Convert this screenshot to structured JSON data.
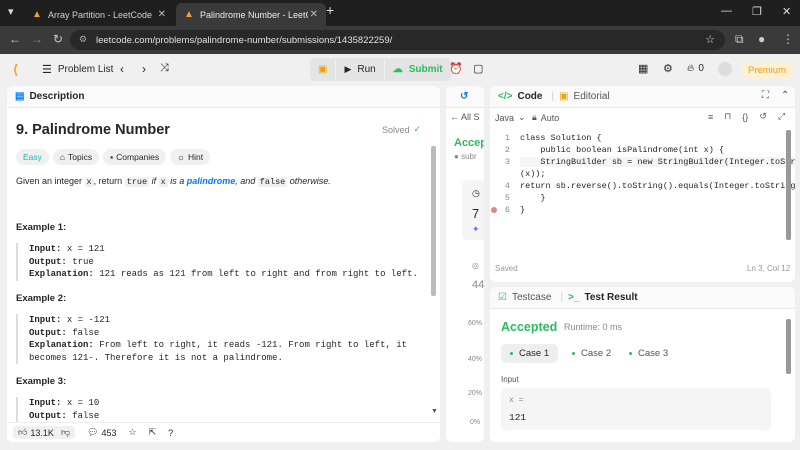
{
  "browser": {
    "tabs": [
      {
        "title": "Array Partition - LeetCode",
        "active": false
      },
      {
        "title": "Palindrome Number - LeetCode",
        "active": true
      }
    ],
    "url": "leetcode.com/problems/palindrome-number/submissions/1435822259/"
  },
  "nav": {
    "problem_list": "Problem List",
    "run": "Run",
    "submit": "Submit",
    "streak": "0",
    "premium": "Premium"
  },
  "description": {
    "tab_label": "Description",
    "title": "9. Palindrome Number",
    "solved": "Solved",
    "tags": [
      "Easy",
      "Topics",
      "Companies",
      "Hint"
    ],
    "intro": {
      "p1": "Given an integer ",
      "c1": "x",
      "p2": ", return ",
      "c2": "true",
      "p3": " if ",
      "c3": "x",
      "p4": " is a ",
      "link": "palindrome",
      "p5": ", and ",
      "c4": "false",
      "p6": " otherwise."
    },
    "examples": [
      {
        "title": "Example 1:",
        "input_label": "Input:",
        "input": "x = 121",
        "output_label": "Output:",
        "output": "true",
        "explanation_label": "Explanation:",
        "explanation": "121 reads as 121 from left to right and from right to left."
      },
      {
        "title": "Example 2:",
        "input_label": "Input:",
        "input": "x = -121",
        "output_label": "Output:",
        "output": "false",
        "explanation_label": "Explanation:",
        "explanation": "From left to right, it reads -121. From right to left, it becomes 121-. Therefore it is not a palindrome."
      },
      {
        "title": "Example 3:",
        "input_label": "Input:",
        "input": "x = 10",
        "output_label": "Output:",
        "output": "false"
      }
    ],
    "likes": "13.1K",
    "comments": "453"
  },
  "submission": {
    "tab_label": "All S",
    "status": "Accep",
    "sub_label": "subr",
    "runtime_digit": "7",
    "stat": "44",
    "axis": [
      "60%",
      "40%",
      "20%",
      "0%"
    ]
  },
  "code": {
    "tab_code": "Code",
    "tab_editorial": "Editorial",
    "language": "Java",
    "mode": "Auto",
    "status": "Saved",
    "cursor": "Ln 3, Col 12",
    "line_numbers": [
      "1",
      "2",
      "3",
      "",
      "4",
      "5",
      "6"
    ],
    "lines": [
      "class Solution {",
      "    public boolean isPalindrome(int x) {",
      "    StringBuilder sb = new StringBuilder(Integer.toString",
      "(x));",
      "return sb.reverse().toString().equals(Integer.toString(x));",
      "    }",
      "}"
    ]
  },
  "tests": {
    "tab_testcase": "Testcase",
    "tab_result": "Test Result",
    "result": "Accepted",
    "runtime": "Runtime: 0 ms",
    "cases": [
      "Case 1",
      "Case 2",
      "Case 3"
    ],
    "input_label": "Input",
    "var_label": "x =",
    "var_value": "121"
  },
  "colors": {
    "accent_green": "#2cbb5d",
    "link_blue": "#007aff",
    "premium": "#f0a000"
  }
}
